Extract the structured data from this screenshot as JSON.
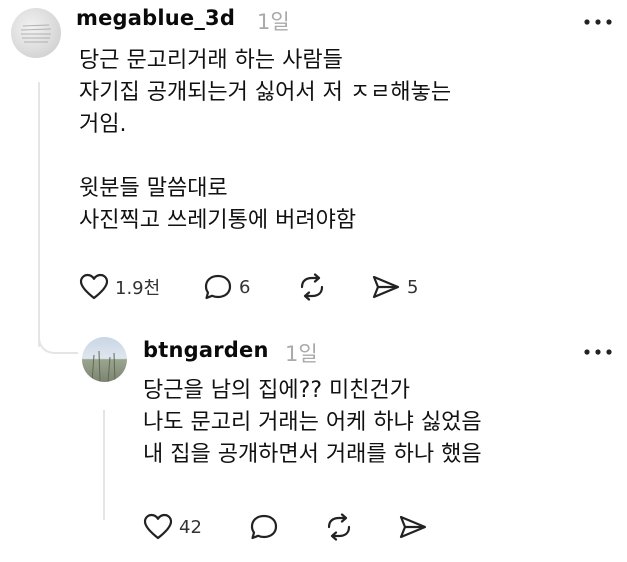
{
  "post": {
    "username": "megablue_3d",
    "time": "1일",
    "paragraph1": [
      "당근 문고리거래 하는 사람들",
      "자기집 공개되는거 싫어서 저 ㅈㄹ해놓는",
      "거임."
    ],
    "paragraph2": [
      "윗분들 말씀대로",
      "사진찍고 쓰레기통에 버려야함"
    ],
    "likes": "1.9천",
    "comments": "6",
    "shares": "5"
  },
  "reply": {
    "username": "btngarden",
    "time": "1일",
    "lines": [
      "당근을 남의 집에?? 미친건가",
      "나도 문고리 거래는 어케 하냐 싫었음",
      "내 집을 공개하면서 거래를 하나 했음"
    ],
    "likes": "42"
  },
  "icons": {
    "like": "heart-icon",
    "comment": "comment-bubble-icon",
    "repost": "repost-icon",
    "share": "send-icon",
    "more": "more-horizontal-icon"
  },
  "colors": {
    "text": "#111111",
    "muted": "#aaaaaa",
    "thread_line": "#e5e5e5"
  }
}
